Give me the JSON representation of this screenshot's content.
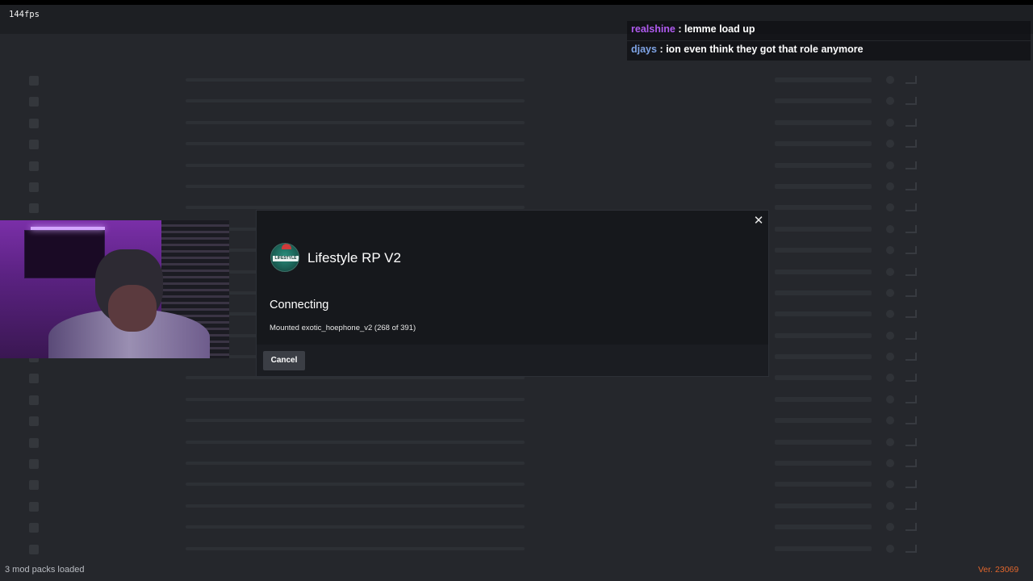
{
  "overlay": {
    "fps": "144fps"
  },
  "chat": [
    {
      "user": "realshine",
      "separator": " : ",
      "message": "lemme load up"
    },
    {
      "user": "djays",
      "separator": " : ",
      "message": "ion even think they got that role anymore"
    }
  ],
  "modal": {
    "close_glyph": "✕",
    "server_name": "Lifestyle RP V2",
    "logo_text": "LIFESTYLE",
    "status_title": "Connecting",
    "status_detail": "Mounted exotic_hoephone_v2 (268 of 391)",
    "cancel_label": "Cancel"
  },
  "footer": {
    "mod_packs": "3 mod packs loaded",
    "version": "Ver. 23069"
  },
  "colors": {
    "background": "#25272c",
    "modal": "#16181c",
    "chat_user_1": "#b05bf0",
    "chat_user_2": "#7fa4e6",
    "version_text": "#e0662c"
  }
}
